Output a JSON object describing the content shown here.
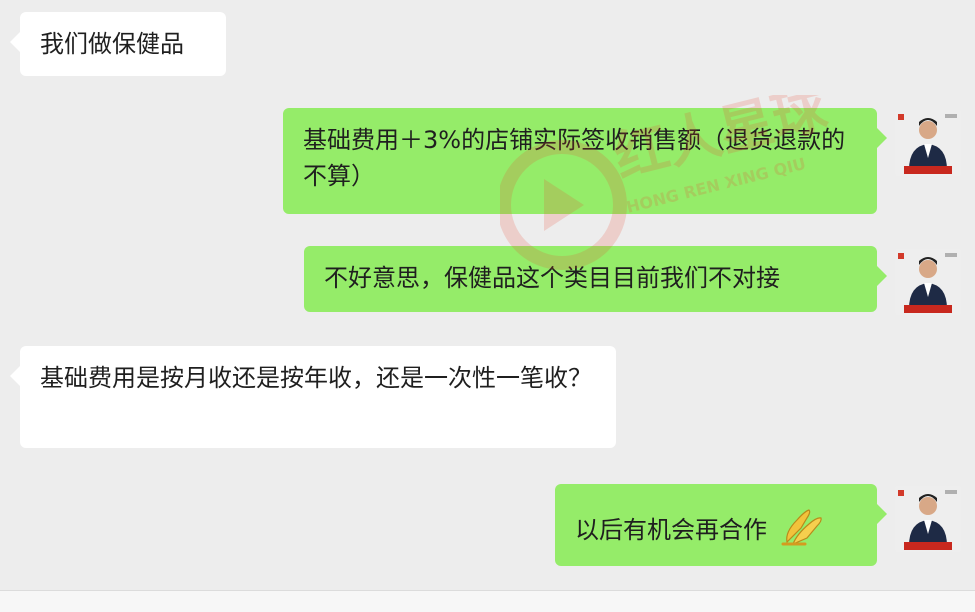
{
  "messages": [
    {
      "side": "in",
      "text": "我们做保健品"
    },
    {
      "side": "out",
      "text": "基础费用＋3%的店铺实际签收销售额（退货退款的不算）"
    },
    {
      "side": "out",
      "text": "不好意思，保健品这个类目目前我们不对接"
    },
    {
      "side": "in",
      "text": "基础费用是按月收还是按年收，还是一次性一笔收？"
    },
    {
      "side": "out",
      "text": "以后有机会再合作",
      "emoji": "pray-emoji"
    }
  ],
  "watermark": {
    "brand_text": "红人星球",
    "pinyin": "HONG REN XING QIU"
  },
  "colors": {
    "background": "#ededed",
    "incoming_bubble": "#ffffff",
    "outgoing_bubble": "#95ec69",
    "watermark": "#e8472f"
  }
}
